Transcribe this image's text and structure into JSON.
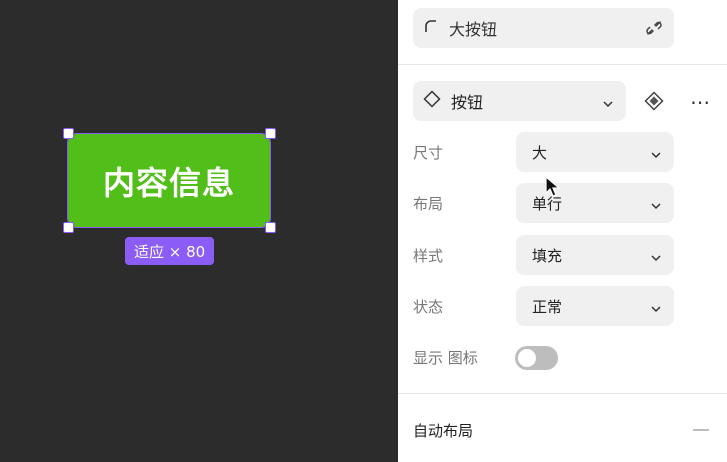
{
  "canvas": {
    "button_text": "内容信息",
    "size_tag": "适应 × 80",
    "button_color": "#52be1a",
    "selection_color": "#8b5cf6"
  },
  "panel": {
    "component_name": "大按钮",
    "variant_label": "按钮",
    "props": [
      {
        "label": "尺寸",
        "value": "大"
      },
      {
        "label": "布局",
        "value": "单行"
      },
      {
        "label": "样式",
        "value": "填充"
      },
      {
        "label": "状态",
        "value": "正常"
      }
    ],
    "show_icon_label": "显示 图标",
    "show_icon_on": false,
    "auto_layout_title": "自动布局"
  }
}
